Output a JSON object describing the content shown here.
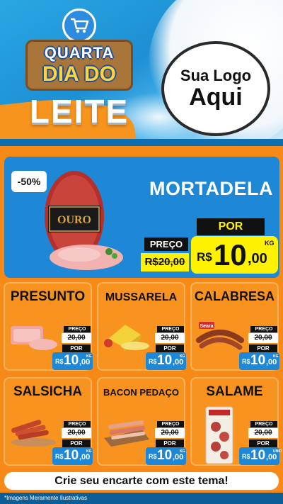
{
  "header": {
    "badge_line1": "QUARTA",
    "badge_line2": "DIA DO",
    "badge_line3": "LEITE",
    "logo_line1": "Sua Logo",
    "logo_line2": "Aqui"
  },
  "featured": {
    "discount": "-50%",
    "name": "MORTADELA",
    "brand_text": "OURO",
    "preco_label": "PREÇO",
    "old_price": "R$20,00",
    "por_label": "POR",
    "currency": "R$",
    "price_int": "10",
    "price_dec": ",00",
    "unit": "KG"
  },
  "products": [
    {
      "name": "PRESUNTO",
      "preco_label": "PREÇO",
      "old_price": "20,00",
      "por_label": "POR",
      "currency": "R$",
      "price_int": "10",
      "price_dec": ",00",
      "unit": "KG"
    },
    {
      "name": "MUSSARELA",
      "preco_label": "PREÇO",
      "old_price": "20,00",
      "por_label": "POR",
      "currency": "R$",
      "price_int": "10",
      "price_dec": ",00",
      "unit": "KG"
    },
    {
      "name": "CALABRESA",
      "brand_text": "Seara",
      "preco_label": "PREÇO",
      "old_price": "20,00",
      "por_label": "POR",
      "currency": "R$",
      "price_int": "10",
      "price_dec": ",00",
      "unit": "KG"
    },
    {
      "name": "SALSICHA",
      "preco_label": "PREÇO",
      "old_price": "20,00",
      "por_label": "POR",
      "currency": "R$",
      "price_int": "10",
      "price_dec": ",00",
      "unit": "KG"
    },
    {
      "name": "BACON PEDAÇO",
      "preco_label": "PREÇO",
      "old_price": "20,00",
      "por_label": "POR",
      "currency": "R$",
      "price_int": "10",
      "price_dec": ",00",
      "unit": "KG"
    },
    {
      "name": "SALAME",
      "preco_label": "PREÇO",
      "old_price": "20,00",
      "por_label": "POR",
      "currency": "R$",
      "price_int": "10",
      "price_dec": ",00",
      "unit": "UNID"
    }
  ],
  "footer": {
    "cta": "Crie seu encarte com este tema!",
    "disclaimer": "*Imagens Meramente Ilustrativas"
  },
  "colors": {
    "orange": "#f7931e",
    "blue": "#1f88d6",
    "yellow": "#fff200"
  }
}
